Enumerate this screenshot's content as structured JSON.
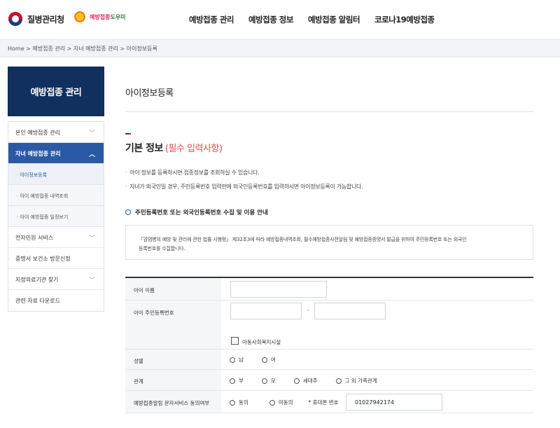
{
  "header": {
    "org_name": "질병관리청",
    "helper_name_a": "예방접종",
    "helper_name_b": "도우미",
    "nav": [
      "예방접종 관리",
      "예방접종 정보",
      "예방접종 알림터",
      "코로나19예방접종"
    ]
  },
  "breadcrumb": "Home > 예방접종 관리 > 자녀 예방접종 관리 > 아이정보등록",
  "sidebar": {
    "title": "예방접종 관리",
    "items": [
      {
        "label": "본인 예방접종 관리",
        "chevron": "﹀"
      },
      {
        "label": "자녀 예방접종 관리",
        "chevron": "︿"
      },
      {
        "label": "· 아이정보등록"
      },
      {
        "label": "· 아이 예방접종 내역조회"
      },
      {
        "label": "· 아이 예방접종 일정보기"
      },
      {
        "label": "전자민원 서비스",
        "chevron": "﹀"
      },
      {
        "label": "증명서 보건소 방문신청"
      },
      {
        "label": "지정의료기관 찾기",
        "chevron": "﹀"
      },
      {
        "label": "관련 자료 다운로드"
      }
    ]
  },
  "main": {
    "page_title": "아이정보등록",
    "section_title": "기본 정보",
    "section_required": "(필수 입력사항)",
    "notices": [
      "아이 정보를 등록하시면 접종정보를 조회하실 수 있습니다.",
      "자녀가 외국인일 경우, 주민등록번호 입력란에 외국인등록번호를 입력하시면 아이정보등록이 가능합니다."
    ],
    "consent_heading": "주민등록번호 또는 외국인등록번호 수집 및 이용 안내",
    "consent_text_1": "「감염병의 예방 및 관리에 관한 법률 시행령」 제32조3에 따라 예방접종내역조회, 필수예방접종사전알림 및 예방접종증명서 발급을 위하여 주민등록번호 또는 외국인",
    "consent_text_2": "등록번호를 수집합니다."
  },
  "form": {
    "child_name_label": "아이 이름",
    "child_name_value": "",
    "rrn_label": "아이 주민등록번호",
    "rrn_front": "",
    "rrn_back": "",
    "rrn_separator": "-",
    "welfare_label": "아동사회복지시설",
    "gender_label": "성별",
    "gender_options": [
      "남",
      "여"
    ],
    "relation_label": "관계",
    "relation_options": [
      "부",
      "모",
      "세대주",
      "그 외 가족관계"
    ],
    "sms_label": "예방접종알림 문자서비스 동의여부",
    "sms_options": [
      "동의",
      "미동의"
    ],
    "phone_label": "* 휴대폰 번호",
    "phone_value": "01027942174"
  }
}
